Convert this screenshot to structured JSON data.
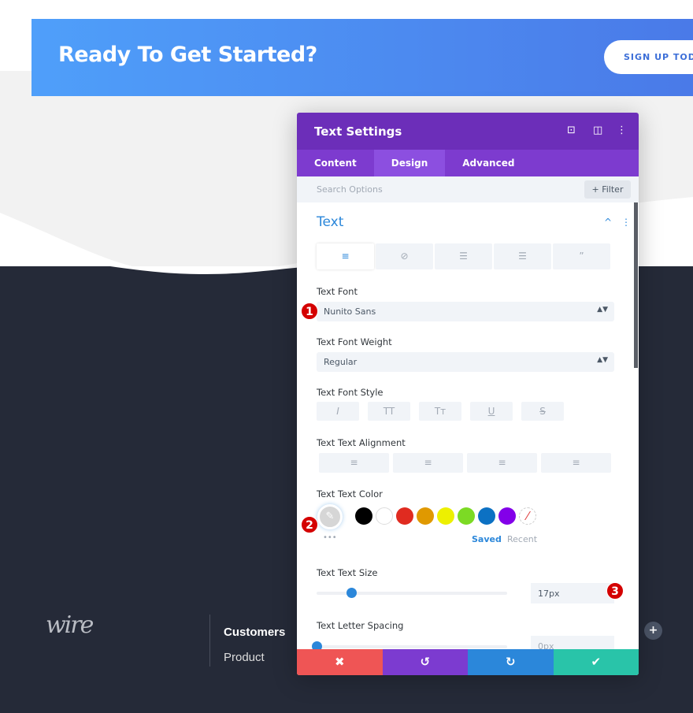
{
  "banner": {
    "title": "Ready To Get Started?",
    "button": "SIGN UP TODA"
  },
  "footer_site": {
    "logo": "wire",
    "column_title": "Customers",
    "link": "Product",
    "add": "+"
  },
  "panel": {
    "title": "Text Settings",
    "header_icons": [
      "focus-icon",
      "sidebar-icon",
      "more-icon"
    ],
    "tabs": [
      {
        "label": "Content"
      },
      {
        "label": "Design",
        "active": true
      },
      {
        "label": "Advanced"
      }
    ],
    "search_placeholder": "Search Options",
    "filter": "+ Filter",
    "section": "Text",
    "text_tabs": [
      "paragraph-icon",
      "link-icon",
      "unordered-list-icon",
      "ordered-list-icon",
      "quote-icon"
    ],
    "font": {
      "label": "Text Font",
      "value": "Nunito Sans"
    },
    "weight": {
      "label": "Text Font Weight",
      "value": "Regular"
    },
    "style": {
      "label": "Text Font Style",
      "buttons": [
        "I",
        "TT",
        "Tт",
        "U",
        "S"
      ]
    },
    "align": {
      "label": "Text Text Alignment"
    },
    "color": {
      "label": "Text Text Color",
      "swatches": [
        "#000000",
        "#ffffff",
        "#e02b20",
        "#e09900",
        "#edf000",
        "#7cda24",
        "#0c71c3",
        "#8300e9"
      ],
      "saved": "Saved",
      "recent": "Recent",
      "more": "•••"
    },
    "size": {
      "label": "Text Text Size",
      "value": "17px",
      "slider_fraction": 0.18
    },
    "spacing": {
      "label": "Text Letter Spacing",
      "value": "0px",
      "slider_fraction": 0
    },
    "badges": [
      "1",
      "2",
      "3"
    ],
    "actions": {
      "cancel": "✖",
      "undo": "↺",
      "redo": "↻",
      "save": "✔",
      "colors": [
        "#ef5555",
        "#7c3bd0",
        "#2b87da",
        "#29c4a9"
      ]
    }
  }
}
